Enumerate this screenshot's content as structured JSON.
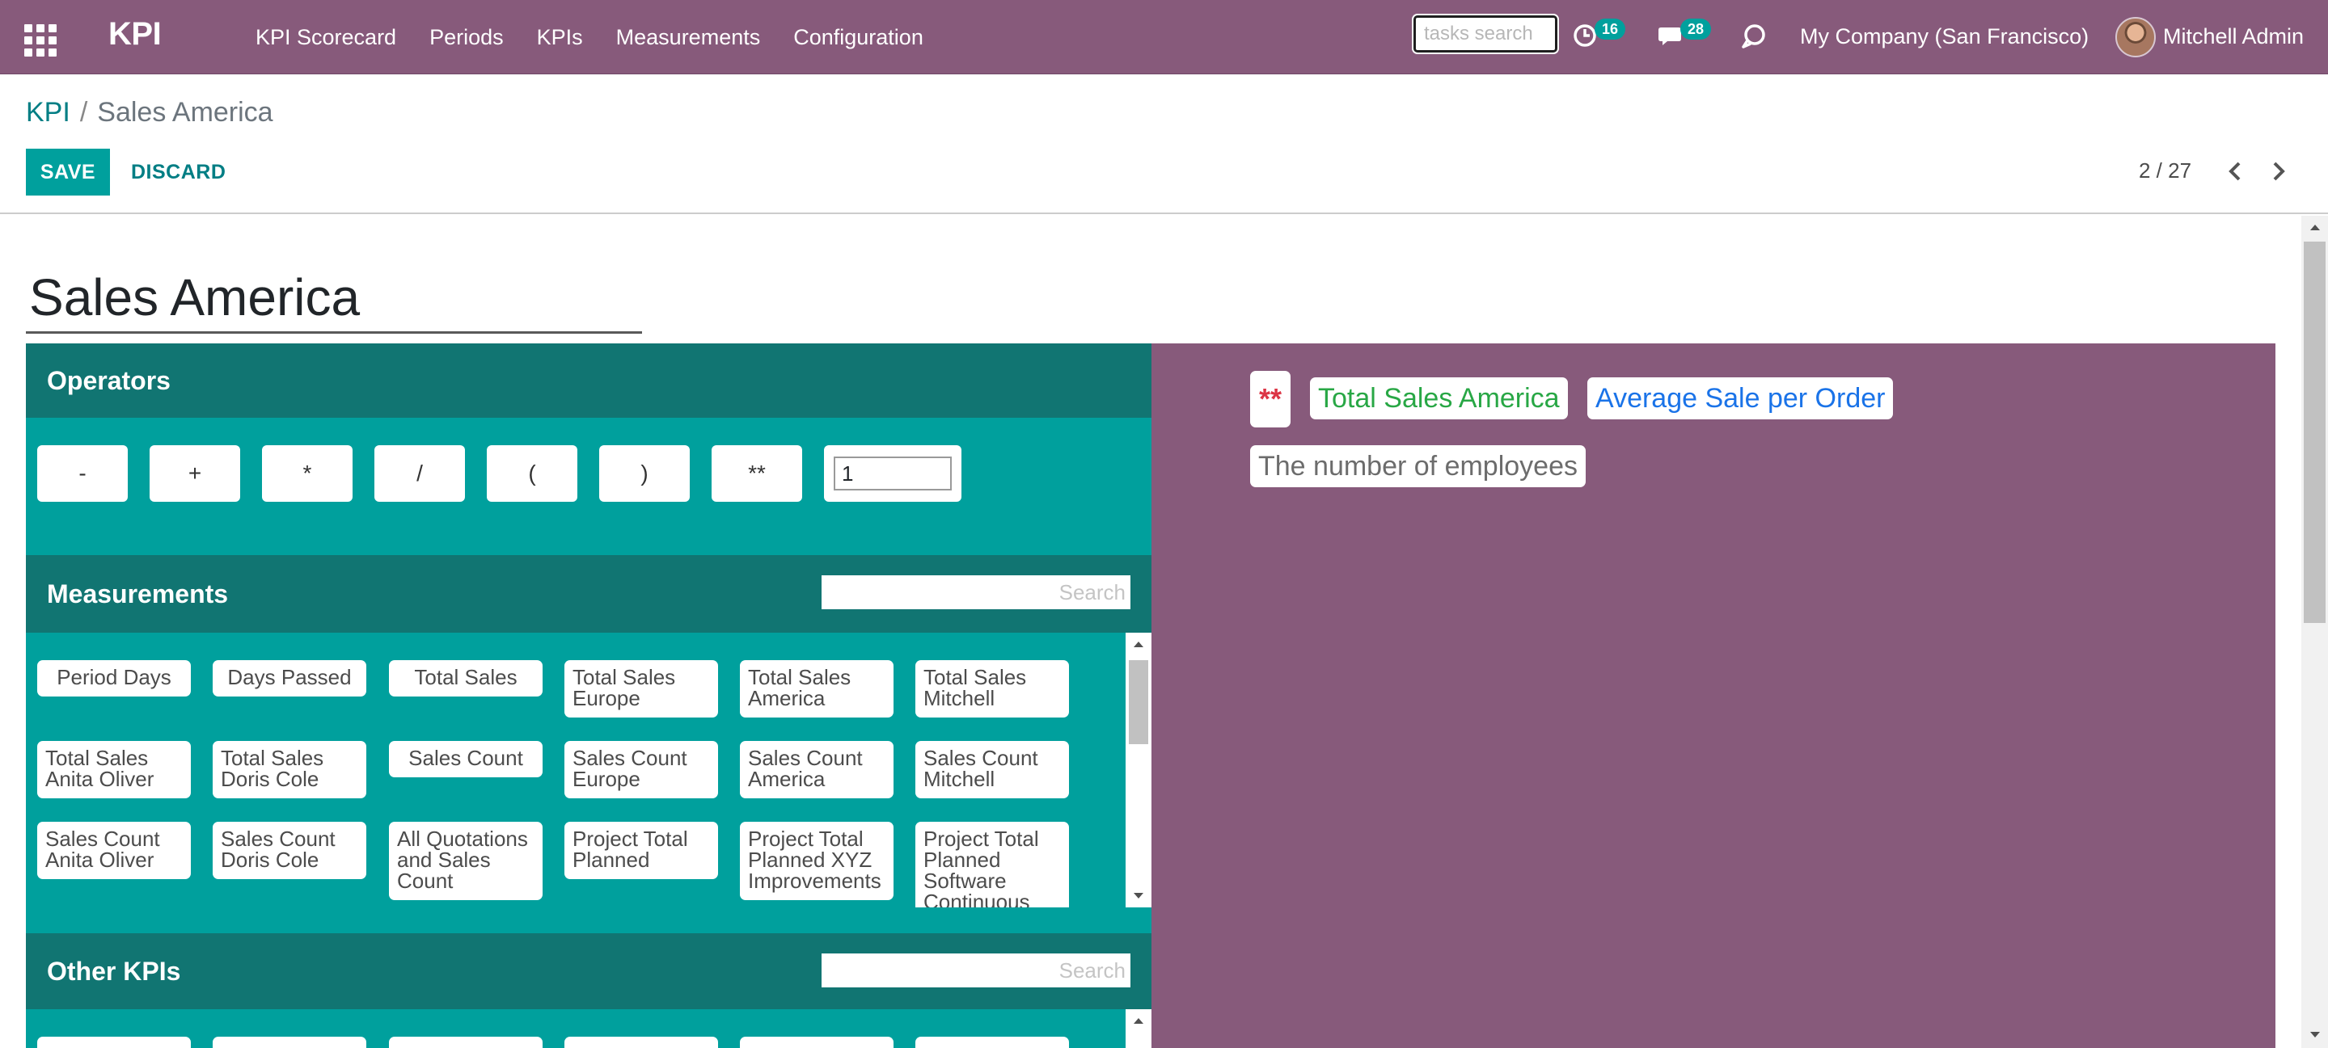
{
  "navbar": {
    "brand": "KPI",
    "menu": [
      "KPI Scorecard",
      "Periods",
      "KPIs",
      "Measurements",
      "Configuration"
    ],
    "search_placeholder": "tasks search",
    "activity_count": "16",
    "message_count": "28",
    "company": "My Company (San Francisco)",
    "user": "Mitchell Admin"
  },
  "breadcrumb": {
    "parent": "KPI",
    "separator": "/",
    "current": "Sales America"
  },
  "actions": {
    "save": "SAVE",
    "discard": "DISCARD"
  },
  "pager": {
    "value": "2 / 27"
  },
  "form": {
    "name": "Sales America"
  },
  "operators": {
    "title": "Operators",
    "buttons": [
      "-",
      "+",
      "*",
      "/",
      "(",
      ")",
      "**"
    ],
    "number_value": "1"
  },
  "measurements": {
    "title": "Measurements",
    "search_placeholder": "Search",
    "items": [
      "Period Days",
      "Days Passed",
      "Total Sales",
      "Total Sales Europe",
      "Total Sales America",
      "Total Sales Mitchell",
      "Total Sales Anita Oliver",
      "Total Sales Doris Cole",
      "Sales Count",
      "Sales Count Europe",
      "Sales Count America",
      "Sales Count Mitchell",
      "Sales Count Anita Oliver",
      "Sales Count Doris Cole",
      "All Quotations and Sales Count",
      "Project Total Planned",
      "Project Total Planned XYZ Improvements",
      "Project Total Planned Software Continuous"
    ]
  },
  "other_kpis": {
    "title": "Other KPIs",
    "search_placeholder": "Search"
  },
  "formula": {
    "tokens": [
      {
        "text": "**",
        "kind": "operator"
      },
      {
        "text": "Total Sales America",
        "kind": "measurement"
      },
      {
        "text": "Average Sale per Order",
        "kind": "kpi"
      },
      {
        "text": "The number of employees",
        "kind": "constant"
      }
    ]
  },
  "colors": {
    "navbar": "#875a7b",
    "primary": "#00a09d",
    "section_header": "#117572",
    "link": "#017e84",
    "operator_token": "#dc3545",
    "measurement_token": "#28a745",
    "kpi_token": "#1a73e8"
  }
}
